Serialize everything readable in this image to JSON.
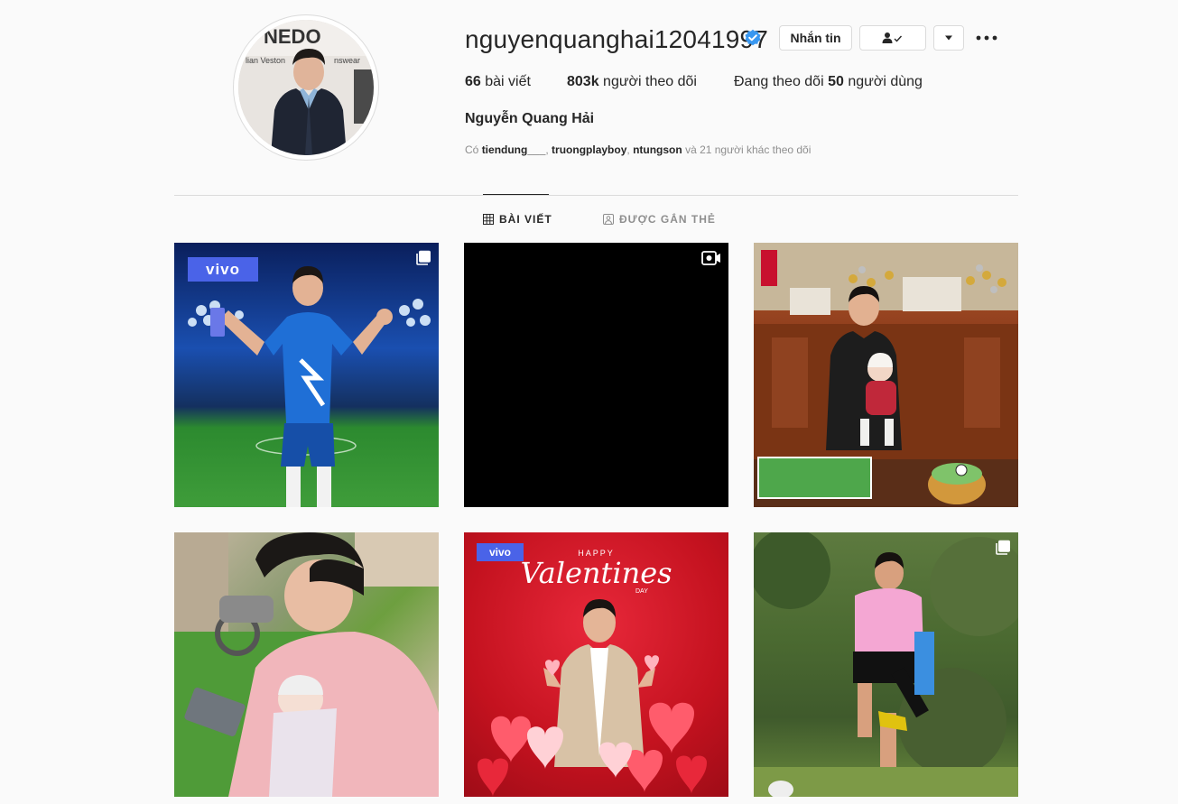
{
  "profile": {
    "username": "nguyenquanghai12041997",
    "full_name": "Nguyễn Quang Hải",
    "verified": true,
    "buttons": {
      "message": "Nhắn tin",
      "follow_icon": "person-check-icon",
      "dropdown_icon": "caret-down-icon",
      "more_icon": "more-dots-icon"
    },
    "stats": {
      "posts_count": "66",
      "posts_label": "bài viết",
      "followers_count": "803k",
      "followers_label": "người theo dõi",
      "following_prefix": "Đang theo dõi",
      "following_count": "50",
      "following_suffix": "người dùng"
    },
    "followed_by": {
      "prefix": "Có",
      "accounts": [
        "tiendung___",
        "truongplayboy",
        "ntungson"
      ],
      "suffix": "và 21 người khác theo dõi"
    },
    "avatar_text": {
      "line1": "NEDO",
      "line2": "lian Veston",
      "line3": "nswear"
    }
  },
  "tabs": [
    {
      "label": "BÀI VIẾT",
      "icon": "grid-icon",
      "active": true
    },
    {
      "label": "ĐƯỢC GẮN THẺ",
      "icon": "tagged-icon",
      "active": false
    }
  ],
  "posts": [
    {
      "badge": "carousel-icon",
      "logo": "vivo"
    },
    {
      "badge": "video-icon"
    },
    {
      "badge": ""
    },
    {
      "badge": ""
    },
    {
      "badge": "",
      "logo": "vivo",
      "happy": "HAPPY",
      "title": "Valentines",
      "day": "DAY"
    },
    {
      "badge": "carousel-icon"
    }
  ],
  "colors": {
    "background": "#fafafa",
    "verified_blue": "#3897f0",
    "vivo_blue": "#4a63e8",
    "divider": "#dbdbdb"
  }
}
